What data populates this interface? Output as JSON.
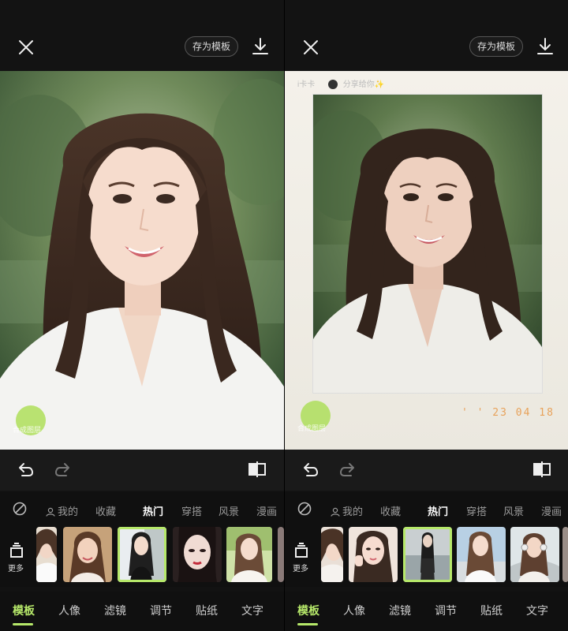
{
  "panels": [
    {
      "header": {
        "save_template_label": "存为模板"
      },
      "watermark": "合成图层",
      "categories": [
        "我的",
        "收藏",
        "热门",
        "穿搭",
        "风景",
        "漫画"
      ],
      "active_category": "热门",
      "more_label": "更多",
      "nav": [
        "模板",
        "人像",
        "滤镜",
        "调节",
        "贴纸",
        "文字"
      ],
      "active_nav": "模板"
    },
    {
      "header": {
        "save_template_label": "存为模板"
      },
      "frame": {
        "caption_left": "i卡卡",
        "caption_right": "分享给你✨",
        "date_stamp": "' ' 23 04 18"
      },
      "watermark": "合成图层",
      "categories": [
        "我的",
        "收藏",
        "热门",
        "穿搭",
        "风景",
        "漫画"
      ],
      "active_category": "热门",
      "more_label": "更多",
      "nav": [
        "模板",
        "人像",
        "滤镜",
        "调节",
        "贴纸",
        "文字"
      ],
      "active_nav": "模板"
    }
  ],
  "colors": {
    "accent": "#b6e86a",
    "background": "#121212",
    "date_stamp": "#e8a25a"
  },
  "icons": [
    "close-icon",
    "download-icon",
    "undo-icon",
    "redo-icon",
    "compare-icon",
    "none-icon",
    "person-icon",
    "layers-icon"
  ]
}
